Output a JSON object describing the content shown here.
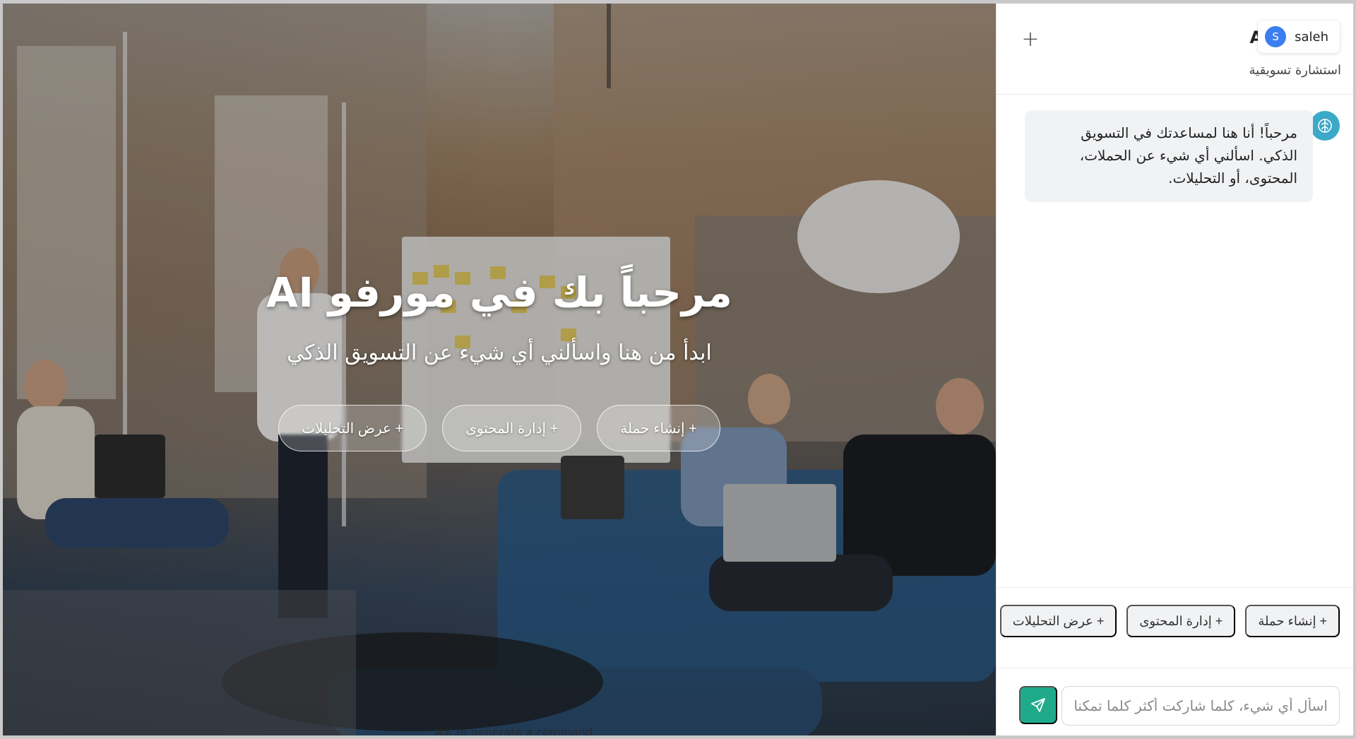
{
  "hero": {
    "title": "مرحباً بك في مورفو AI",
    "subtitle": "ابدأ من هنا واسألني أي شيء عن التسويق الذكي",
    "actions": [
      "+ إنشاء حملة",
      "+ إدارة المحتوى",
      "+ عرض التحليلات"
    ],
    "footer_hint": "⌘K to generate a command"
  },
  "chat": {
    "new_chat_label": "+",
    "title": "AI",
    "user": {
      "initial": "S",
      "name": "saleh"
    },
    "subtitle": "استشارة تسويقية",
    "messages": [
      {
        "role": "assistant",
        "icon": "brain-icon",
        "text": "مرحباً! أنا هنا لمساعدتك في التسويق الذكي. اسألني أي شيء عن الحملات، المحتوى، أو التحليلات."
      }
    ],
    "quick_actions": [
      "+ إنشاء حملة",
      "+ إدارة المحتوى",
      "+ عرض التحليلات"
    ],
    "input": {
      "placeholder": "اسأل أي شيء، كلما شاركت أكثر كلما تمكنا",
      "value": ""
    },
    "send_icon": "send-icon"
  },
  "colors": {
    "accent": "#1fab8b",
    "avatar": "#3b7ef0",
    "bot_avatar": "#3ba9c7"
  }
}
